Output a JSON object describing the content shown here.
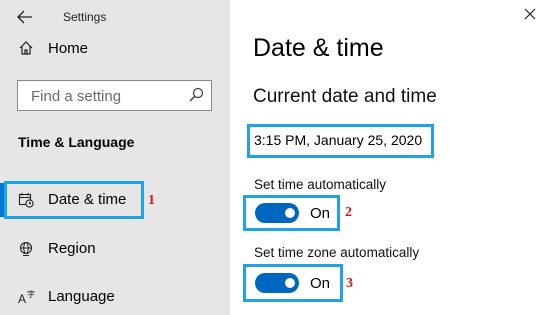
{
  "window": {
    "title": "Settings"
  },
  "sidebar": {
    "home_label": "Home",
    "search_placeholder": "Find a setting",
    "section_heading": "Time & Language",
    "items": [
      {
        "label": "Date & time",
        "icon": "calendar-clock-icon",
        "selected": true
      },
      {
        "label": "Region",
        "icon": "region-icon",
        "selected": false
      },
      {
        "label": "Language",
        "icon": "language-icon",
        "selected": false
      }
    ]
  },
  "main": {
    "page_title": "Date & time",
    "subheading": "Current date and time",
    "current_datetime": "3:15 PM, January 25, 2020",
    "set_time_auto": {
      "label": "Set time automatically",
      "state": "On",
      "enabled": true
    },
    "set_timezone_auto": {
      "label": "Set time zone automatically",
      "state": "On",
      "enabled": true
    }
  },
  "annotations": {
    "marker_1": "1",
    "marker_2": "2",
    "marker_3": "3"
  },
  "colors": {
    "sidebar_bg": "#e6e6e6",
    "accent": "#0078d7",
    "toggle_on": "#0067c0",
    "highlight_box": "#1fa3e8",
    "marker_text": "#d4161c"
  }
}
